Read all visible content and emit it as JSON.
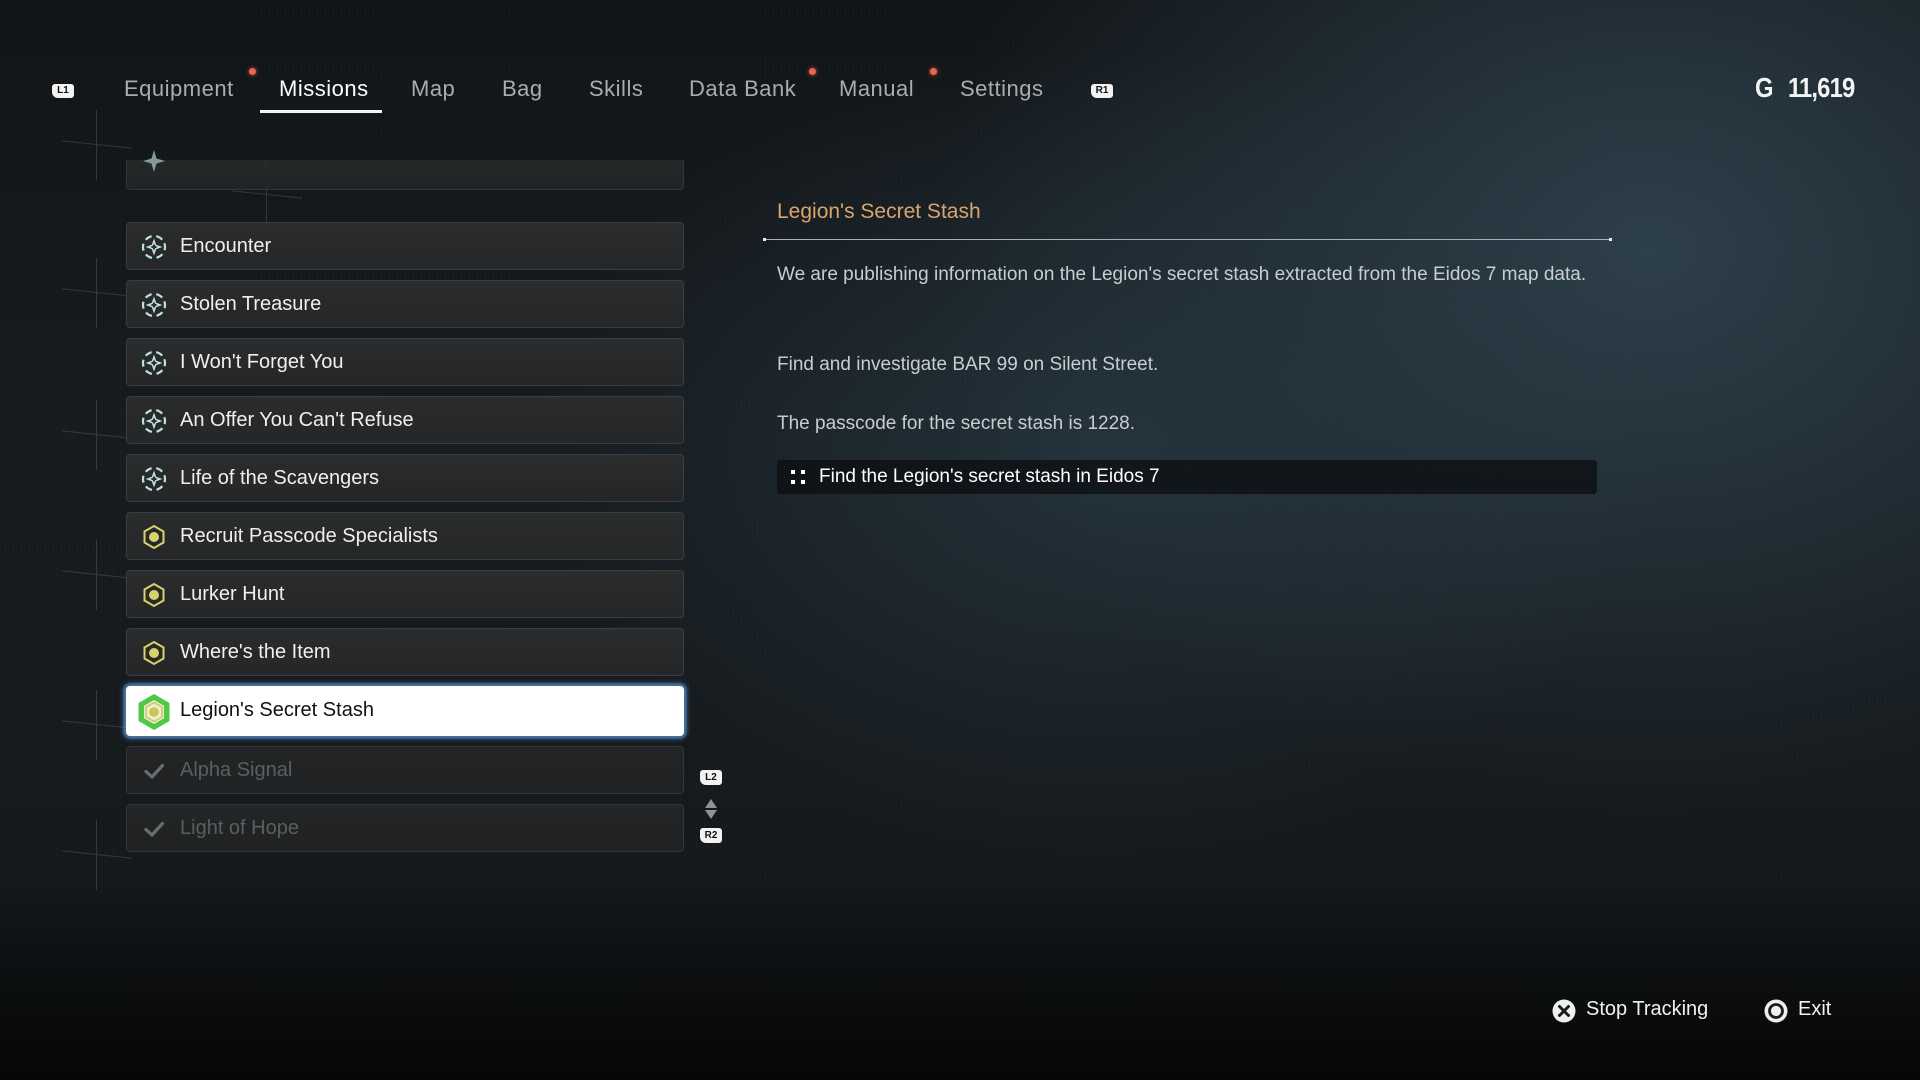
{
  "nav": {
    "left_bumper": "L1",
    "right_bumper": "R1",
    "tabs": [
      {
        "label": "Equipment",
        "active": false,
        "notification": true
      },
      {
        "label": "Missions",
        "active": true,
        "notification": false
      },
      {
        "label": "Map",
        "active": false,
        "notification": false
      },
      {
        "label": "Bag",
        "active": false,
        "notification": false
      },
      {
        "label": "Skills",
        "active": false,
        "notification": false
      },
      {
        "label": "Data Bank",
        "active": false,
        "notification": true
      },
      {
        "label": "Manual",
        "active": false,
        "notification": true
      },
      {
        "label": "Settings",
        "active": false,
        "notification": false
      }
    ]
  },
  "currency": {
    "symbol": "G",
    "amount": "11,619"
  },
  "missions": {
    "items": [
      {
        "label": "Encounter",
        "type": "side-request",
        "status": "active"
      },
      {
        "label": "Stolen Treasure",
        "type": "side-request",
        "status": "active"
      },
      {
        "label": "I Won't Forget You",
        "type": "side-request",
        "status": "active"
      },
      {
        "label": "An Offer You Can't Refuse",
        "type": "side-request",
        "status": "active"
      },
      {
        "label": "Life of the Scavengers",
        "type": "side-request",
        "status": "active"
      },
      {
        "label": "Recruit Passcode Specialists",
        "type": "bounty",
        "status": "active"
      },
      {
        "label": "Lurker Hunt",
        "type": "bounty",
        "status": "active"
      },
      {
        "label": "Where's the Item",
        "type": "bounty",
        "status": "active"
      },
      {
        "label": "Legion's Secret Stash",
        "type": "bounty",
        "status": "tracked-selected"
      },
      {
        "label": "Alpha Signal",
        "type": "completed",
        "status": "completed"
      },
      {
        "label": "Light of Hope",
        "type": "completed",
        "status": "completed"
      }
    ],
    "scroll_up_button": "L2",
    "scroll_down_button": "R2"
  },
  "detail": {
    "title": "Legion's Secret Stash",
    "paragraphs": [
      "We are publishing information on the Legion's secret stash extracted from the Eidos 7 map data.",
      "Find and investigate BAR 99 on Silent Street.",
      "The passcode for the secret stash is 1228."
    ],
    "objective": "Find the Legion's secret stash in Eidos 7"
  },
  "footer": {
    "stop_tracking": {
      "button": "cross-button",
      "label": "Stop Tracking"
    },
    "exit": {
      "button": "circle-button",
      "label": "Exit"
    }
  },
  "colors": {
    "accent_title": "#d9a56c",
    "notification_dot": "#e8674a",
    "side_request_icon": "#bfe3dc",
    "bounty_icon": "#d8d26a",
    "tracked_icon": "#52c74a"
  }
}
